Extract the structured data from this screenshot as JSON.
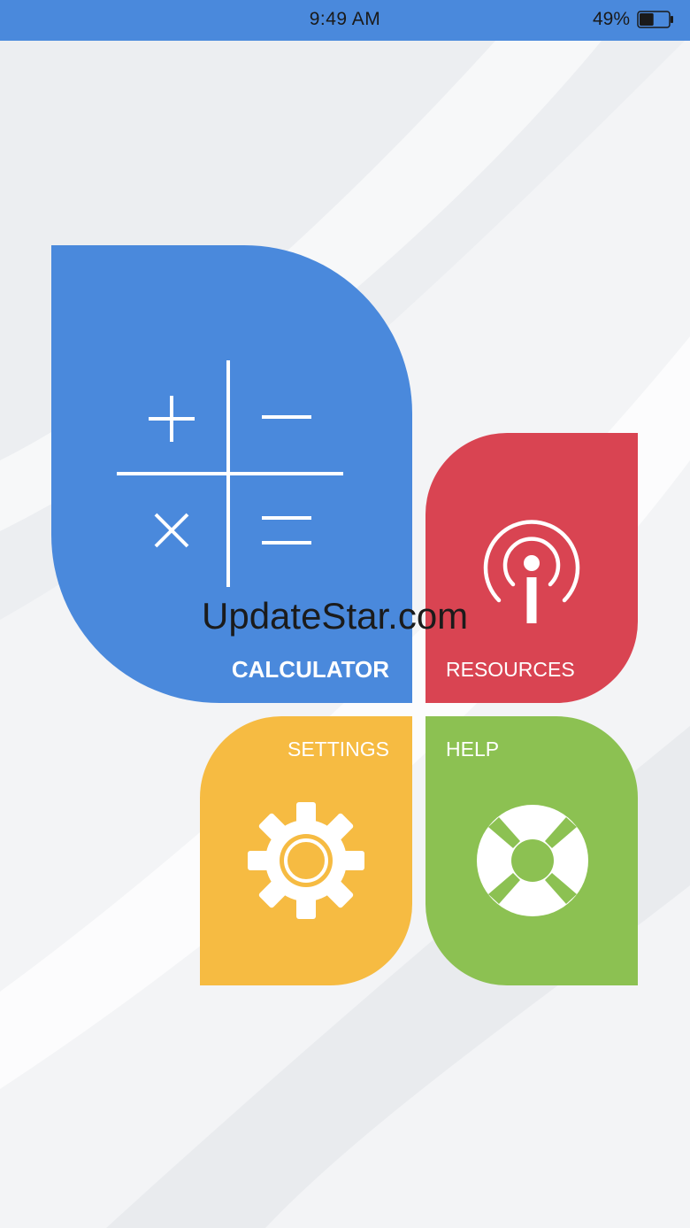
{
  "status_bar": {
    "time": "9:49 AM",
    "battery_percent": "49%",
    "battery_level": 0.49
  },
  "tiles": {
    "calculator": {
      "label": "CALCULATOR",
      "icon": "calculator-icon",
      "color": "#4a89dc"
    },
    "resources": {
      "label": "RESOURCES",
      "icon": "info-broadcast-icon",
      "color": "#d94452"
    },
    "settings": {
      "label": "SETTINGS",
      "icon": "gear-icon",
      "color": "#f6bb42"
    },
    "help": {
      "label": "HELP",
      "icon": "lifebuoy-icon",
      "color": "#8cc152"
    }
  },
  "watermark": "UpdateStar.com"
}
